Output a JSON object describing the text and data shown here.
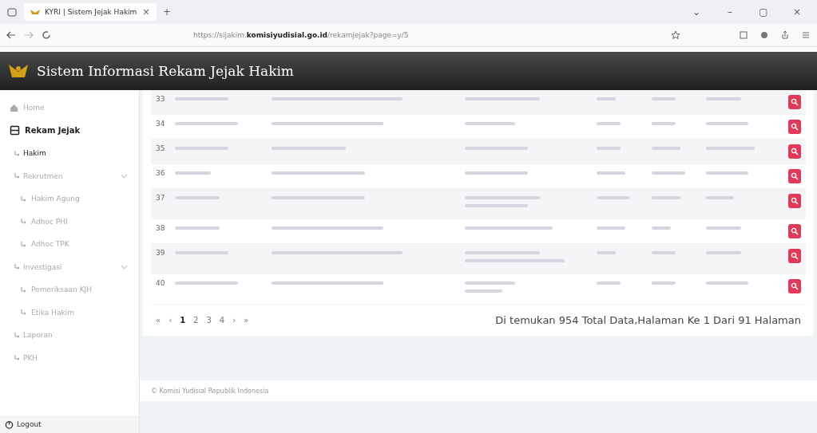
{
  "browser": {
    "tab_title": "KYRI | Sistem Jejak Hakim",
    "tab_close": "×",
    "new_tab": "+",
    "url_host": "https://sijakim.",
    "url_domain": "komisiyudisial.go.id",
    "url_path": "/rekamjejak?page=y/5",
    "window_controls": [
      "⌄",
      "–",
      "▢",
      "×"
    ]
  },
  "header": {
    "title": "Sistem Informasi Rekam Jejak Hakim"
  },
  "sidebar": {
    "items": [
      {
        "label": "Home",
        "kind": "top",
        "selected": false
      },
      {
        "label": "Rekam Jejak",
        "kind": "section",
        "selected": true
      },
      {
        "label": "Hakim",
        "kind": "sub",
        "selected": true
      },
      {
        "label": "Rekrutmen",
        "kind": "sub",
        "selected": false,
        "expanded": true,
        "children": [
          {
            "label": "Hakim Agung"
          },
          {
            "label": "Adhoc PHI"
          },
          {
            "label": "Adhoc TPK"
          }
        ]
      },
      {
        "label": "Investigasi",
        "kind": "sub",
        "selected": false,
        "expanded": true,
        "children": [
          {
            "label": "Pemeriksaan KJH"
          },
          {
            "label": "Etika Hakim"
          }
        ]
      },
      {
        "label": "Laporan",
        "kind": "sub",
        "selected": false
      },
      {
        "label": "PKH",
        "kind": "sub",
        "selected": false
      }
    ],
    "logout": "Logout"
  },
  "table": {
    "rows": [
      {
        "no": "33",
        "wrapped": false
      },
      {
        "no": "34",
        "wrapped": false
      },
      {
        "no": "35",
        "wrapped": false
      },
      {
        "no": "36",
        "wrapped": false
      },
      {
        "no": "37",
        "wrapped": true
      },
      {
        "no": "38",
        "wrapped": false
      },
      {
        "no": "39",
        "wrapped": true
      },
      {
        "no": "40",
        "wrapped": true
      }
    ]
  },
  "pagination": {
    "items": [
      {
        "label": "«",
        "selected": false
      },
      {
        "label": "‹",
        "selected": false
      },
      {
        "label": "1",
        "selected": true
      },
      {
        "label": "2",
        "selected": false
      },
      {
        "label": "3",
        "selected": false
      },
      {
        "label": "4",
        "selected": false
      },
      {
        "label": "›",
        "selected": false
      },
      {
        "label": "»",
        "selected": false
      }
    ],
    "summary": "Di temukan 954 Total Data,Halaman Ke 1 Dari 91 Halaman"
  },
  "footer": "© Komisi Yudisial Republik Indonesia"
}
